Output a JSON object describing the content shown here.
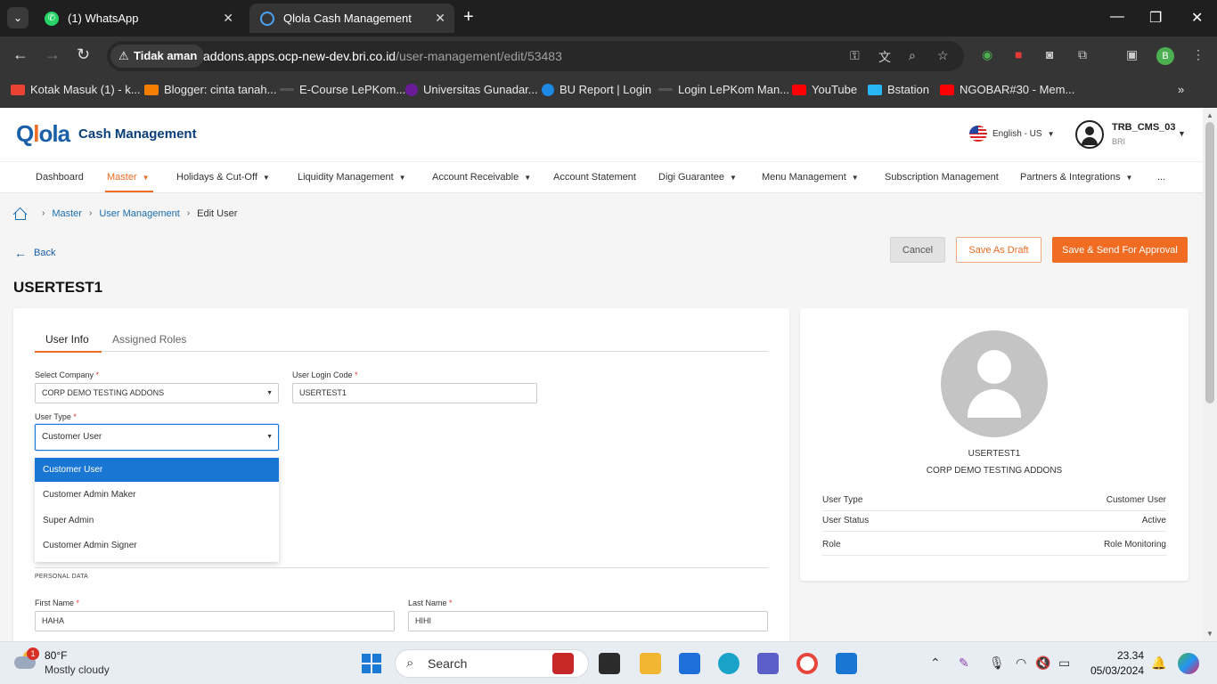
{
  "browser": {
    "tabs": [
      {
        "title": "(1) WhatsApp"
      },
      {
        "title": "Qlola Cash Management"
      }
    ],
    "security_label": "Tidak aman",
    "url_host": "addons.apps.ocp-new-dev.bri.co.id",
    "url_path": "/user-management/edit/53483",
    "profile_initial": "B",
    "bookmarks": [
      {
        "label": "Kotak Masuk (1) - k..."
      },
      {
        "label": "Blogger: cinta tanah..."
      },
      {
        "label": "E-Course LePKom..."
      },
      {
        "label": "Universitas Gunadar..."
      },
      {
        "label": "BU Report | Login"
      },
      {
        "label": "Login LePKom Man..."
      },
      {
        "label": "YouTube"
      },
      {
        "label": "Bstation"
      },
      {
        "label": "NGOBAR#30 - Mem..."
      }
    ]
  },
  "header": {
    "logo_text": "Cash Management",
    "language": "English - US",
    "user_name": "TRB_CMS_03",
    "user_bank": "BRI"
  },
  "nav": {
    "items": [
      {
        "label": "Dashboard"
      },
      {
        "label": "Master"
      },
      {
        "label": "Holidays & Cut-Off"
      },
      {
        "label": "Liquidity Management"
      },
      {
        "label": "Account Receivable"
      },
      {
        "label": "Account Statement"
      },
      {
        "label": "Digi Guarantee"
      },
      {
        "label": "Menu Management"
      },
      {
        "label": "Subscription Management"
      },
      {
        "label": "Partners & Integrations"
      },
      {
        "label": "..."
      }
    ]
  },
  "breadcrumb": {
    "items": [
      "Master",
      "User Management",
      "Edit User"
    ]
  },
  "actions": {
    "back": "Back",
    "cancel": "Cancel",
    "save_draft": "Save As Draft",
    "save_send": "Save & Send For Approval"
  },
  "page_title": "USERTEST1",
  "form": {
    "tabs": [
      "User Info",
      "Assigned Roles"
    ],
    "company_label": "Select Company",
    "company_value": "CORP DEMO TESTING ADDONS",
    "login_code_label": "User Login Code",
    "login_code_value": "USERTEST1",
    "user_type_label": "User Type",
    "user_type_value": "Customer User",
    "user_type_options": [
      "Customer User",
      "Customer Admin Maker",
      "Super Admin",
      "Customer Admin Signer"
    ],
    "personal_data_title": "PERSONAL DATA",
    "first_name_label": "First Name",
    "first_name_value": "HAHA",
    "last_name_label": "Last Name",
    "last_name_value": "HIHI",
    "required_mark": "*"
  },
  "profile_card": {
    "name": "USERTEST1",
    "company": "CORP DEMO TESTING ADDONS",
    "rows": [
      {
        "key": "User Type",
        "value": "Customer User"
      },
      {
        "key": "User Status",
        "value": "Active"
      },
      {
        "key": "Role",
        "value": "Role Monitoring"
      }
    ]
  },
  "taskbar": {
    "temperature": "80°F",
    "condition": "Mostly cloudy",
    "weather_badge": "1",
    "search_placeholder": "Search",
    "time": "23.34",
    "date": "05/03/2024"
  }
}
